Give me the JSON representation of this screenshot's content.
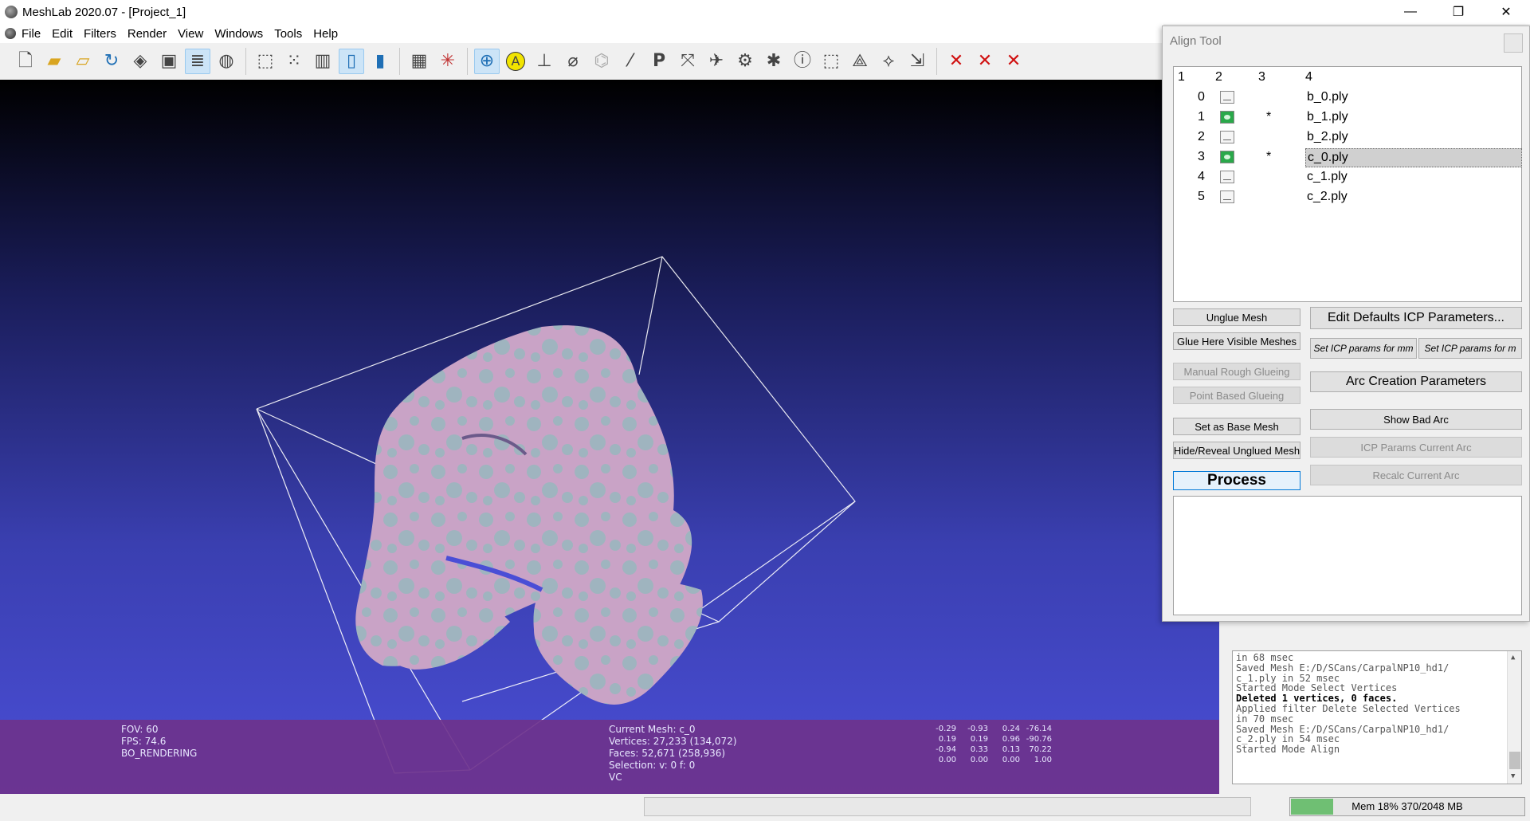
{
  "window": {
    "title": "MeshLab 2020.07 - [Project_1]",
    "minimize": "—",
    "maximize": "❐",
    "close": "✕"
  },
  "menu": [
    "File",
    "Edit",
    "Filters",
    "Render",
    "View",
    "Windows",
    "Tools",
    "Help"
  ],
  "toolbar": {
    "icons": [
      "new-project-icon",
      "open-project-icon",
      "open-mesh-icon",
      "reload-icon",
      "save-icon",
      "snapshot-icon",
      "layers-icon",
      "render-icon",
      "bbox-icon",
      "points-icon",
      "wireframe-icon",
      "flat-icon",
      "smooth-icon",
      "color-icon",
      "axis-icon",
      "trackball-icon",
      "annotate-icon",
      "measure-icon",
      "paint-icon",
      "pickpoints-icon",
      "brush-icon",
      "p-icon",
      "select-icon",
      "align-icon",
      "reference-icon",
      "georef-icon",
      "info-icon",
      "select-faces-icon",
      "select-vertices-icon",
      "select-connected-icon",
      "select-conn-icon",
      "delete-faces-icon",
      "delete-vertices-icon",
      "delete-all-icon"
    ]
  },
  "viewport": {
    "fov": "FOV: 60",
    "fps": "FPS:    74.6",
    "rendering": "BO_RENDERING",
    "current_mesh": "Current Mesh: c_0",
    "vertices": "Vertices: 27,233    (134,072)",
    "faces": "Faces: 52,671    (258,936)",
    "selection": "Selection: v: 0 f: 0",
    "vc": "VC",
    "matrix": [
      [
        "-0.29",
        "-0.93",
        "0.24",
        "-76.14"
      ],
      [
        "0.19",
        "0.19",
        "0.96",
        "-90.76"
      ],
      [
        "-0.94",
        "0.33",
        "0.13",
        "70.22"
      ],
      [
        "0.00",
        "0.00",
        "0.00",
        "1.00"
      ]
    ]
  },
  "align_tool": {
    "title": "Align Tool",
    "headers": [
      "1",
      "2",
      "3",
      "4"
    ],
    "meshes": [
      {
        "id": "0",
        "visible": false,
        "glued": "",
        "name": "b_0.ply",
        "selected": false
      },
      {
        "id": "1",
        "visible": true,
        "glued": "*",
        "name": "b_1.ply",
        "selected": false
      },
      {
        "id": "2",
        "visible": false,
        "glued": "",
        "name": "b_2.ply",
        "selected": false
      },
      {
        "id": "3",
        "visible": true,
        "glued": "*",
        "name": "c_0.ply",
        "selected": true
      },
      {
        "id": "4",
        "visible": false,
        "glued": "",
        "name": "c_1.ply",
        "selected": false
      },
      {
        "id": "5",
        "visible": false,
        "glued": "",
        "name": "c_2.ply",
        "selected": false
      }
    ],
    "buttons": {
      "unglue": "Unglue Mesh",
      "glue_visible": "Glue Here Visible Meshes",
      "manual_rough": "Manual Rough Glueing",
      "point_based": "Point Based Glueing",
      "set_base": "Set as Base Mesh",
      "hide_reveal": "Hide/Reveal Unglued Mesh",
      "process": "Process",
      "edit_icp": "Edit Defaults ICP Parameters...",
      "icp_mm": "Set ICP params for mm",
      "icp_m": "Set ICP params for m",
      "arc_params": "Arc Creation Parameters",
      "show_bad_arc": "Show Bad Arc",
      "icp_current_arc": "ICP Params Current Arc",
      "recalc_arc": "Recalc Current Arc"
    }
  },
  "log": {
    "lines": [
      {
        "text": "in 68 msec",
        "bold": false
      },
      {
        "text": "Saved Mesh E:/D/SCans/CarpalNP10_hd1/",
        "bold": false
      },
      {
        "text": "c_1.ply in 52 msec",
        "bold": false
      },
      {
        "text": "Started Mode Select Vertices",
        "bold": false
      },
      {
        "text": "Deleted 1 vertices, 0 faces.",
        "bold": true
      },
      {
        "text": "Applied filter Delete Selected Vertices",
        "bold": false
      },
      {
        "text": "in 70 msec",
        "bold": false
      },
      {
        "text": "Saved Mesh E:/D/SCans/CarpalNP10_hd1/",
        "bold": false
      },
      {
        "text": "c_2.ply in 54 msec",
        "bold": false
      },
      {
        "text": "Started Mode Align",
        "bold": false
      }
    ]
  },
  "status": {
    "mem_text": "Mem 18% 370/2048 MB",
    "mem_fraction": 0.18
  }
}
